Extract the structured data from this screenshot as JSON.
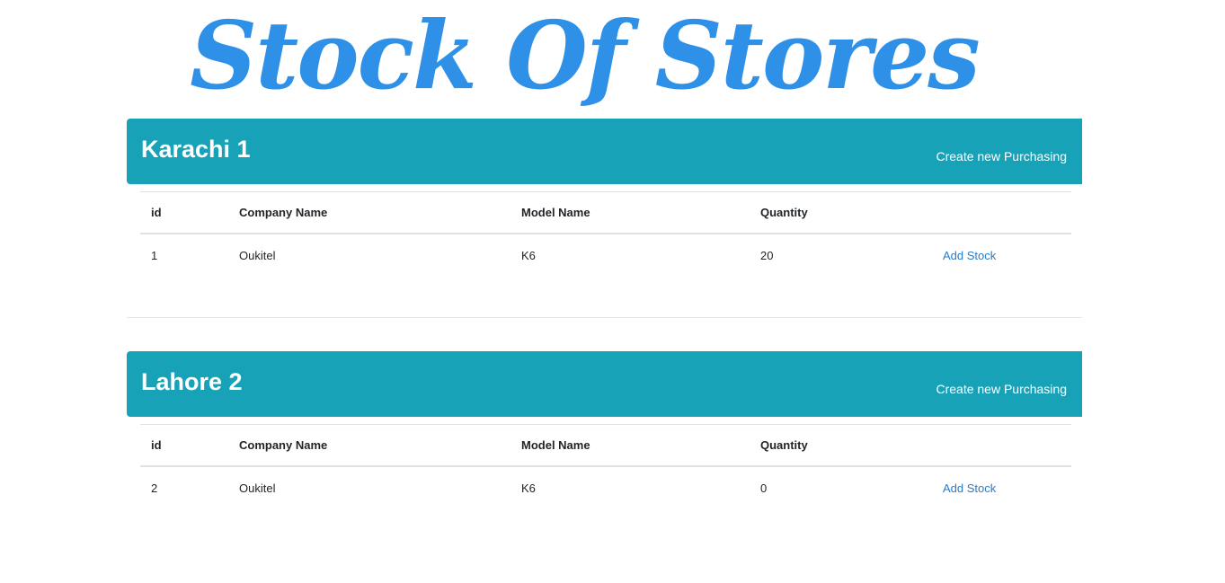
{
  "title": "Stock Of Stores",
  "columns": {
    "id": "id",
    "company": "Company Name",
    "model": "Model Name",
    "quantity": "Quantity"
  },
  "stores": [
    {
      "name": "Karachi 1",
      "create_label": "Create new Purchasing",
      "rows": [
        {
          "id": "1",
          "company": "Oukitel",
          "model": "K6",
          "quantity": "20",
          "action": "Add Stock"
        }
      ]
    },
    {
      "name": "Lahore 2",
      "create_label": "Create new Purchasing",
      "rows": [
        {
          "id": "2",
          "company": "Oukitel",
          "model": "K6",
          "quantity": "0",
          "action": "Add Stock"
        }
      ]
    }
  ],
  "colors": {
    "header_bg": "#17a2b8",
    "title": "#2e90e6",
    "link": "#2a7bc8"
  }
}
